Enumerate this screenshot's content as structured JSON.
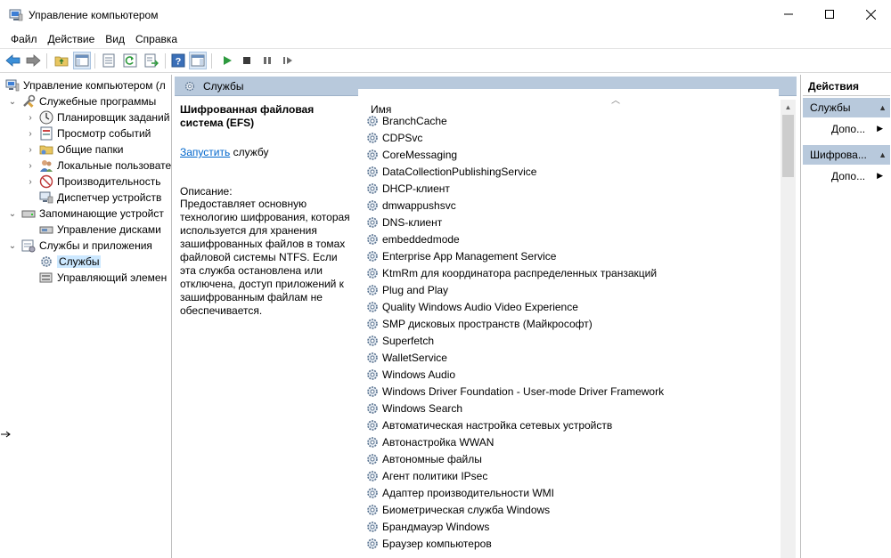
{
  "window": {
    "title": "Управление компьютером",
    "icon": "computer-management-icon"
  },
  "menu": [
    "Файл",
    "Действие",
    "Вид",
    "Справка"
  ],
  "toolbar": {
    "icons": [
      "back-arrow-icon",
      "forward-arrow-icon",
      "up-folder-icon",
      "show-hide-tree-icon",
      "properties-icon",
      "refresh-icon",
      "export-list-icon",
      "help-icon",
      "show-hide-action-pane-icon",
      "start-service-icon",
      "stop-service-icon",
      "pause-service-icon",
      "resume-service-icon"
    ]
  },
  "tree": {
    "items": [
      {
        "label": "Управление компьютером (л",
        "level": 0,
        "expander": "",
        "icon": "computer-management-icon"
      },
      {
        "label": "Служебные программы",
        "level": 1,
        "expander": "expanded",
        "icon": "tools-icon"
      },
      {
        "label": "Планировщик заданий",
        "level": 2,
        "expander": "collapsed",
        "icon": "clock-icon"
      },
      {
        "label": "Просмотр событий",
        "level": 2,
        "expander": "collapsed",
        "icon": "event-viewer-icon"
      },
      {
        "label": "Общие папки",
        "level": 2,
        "expander": "collapsed",
        "icon": "shared-folder-icon"
      },
      {
        "label": "Локальные пользовате",
        "level": 2,
        "expander": "collapsed",
        "icon": "users-icon"
      },
      {
        "label": "Производительность",
        "level": 2,
        "expander": "collapsed",
        "icon": "performance-icon"
      },
      {
        "label": "Диспетчер устройств",
        "level": 2,
        "expander": "",
        "icon": "device-manager-icon"
      },
      {
        "label": "Запоминающие устройст",
        "level": 1,
        "expander": "expanded",
        "icon": "storage-icon"
      },
      {
        "label": "Управление дисками",
        "level": 2,
        "expander": "",
        "icon": "disk-management-icon"
      },
      {
        "label": "Службы и приложения",
        "level": 1,
        "expander": "expanded",
        "icon": "services-apps-icon"
      },
      {
        "label": "Службы",
        "level": 2,
        "expander": "",
        "icon": "services-gear-icon",
        "selected": true
      },
      {
        "label": "Управляющий элемен",
        "level": 2,
        "expander": "",
        "icon": "wmi-control-icon"
      }
    ]
  },
  "center": {
    "header": "Службы",
    "detail": {
      "service_name": "Шифрованная файловая система (EFS)",
      "start_link": "Запустить",
      "start_suffix": " службу",
      "description_label": "Описание:",
      "description": "Предоставляет основную технологию шифрования, которая используется для хранения зашифрованных файлов в томах файловой системы NTFS. Если эта служба остановлена или отключена, доступ приложений к зашифрованным файлам не обеспечивается."
    },
    "list": {
      "column_name": "Имя",
      "services": [
        "BranchCache",
        "CDPSvc",
        "CoreMessaging",
        "DataCollectionPublishingService",
        "DHCP-клиент",
        "dmwappushsvc",
        "DNS-клиент",
        "embeddedmode",
        "Enterprise App Management Service",
        "KtmRm для координатора распределенных транзакций",
        "Plug and Play",
        "Quality Windows Audio Video Experience",
        "SMP дисковых пространств (Майкрософт)",
        "Superfetch",
        "WalletService",
        "Windows Audio",
        "Windows Driver Foundation - User-mode Driver Framework",
        "Windows Search",
        "Автоматическая настройка сетевых устройств",
        "Автонастройка WWAN",
        "Автономные файлы",
        "Агент политики IPsec",
        "Адаптер производительности WMI",
        "Биометрическая служба Windows",
        "Брандмауэр Windows",
        "Браузер компьютеров"
      ]
    }
  },
  "actions": {
    "title": "Действия",
    "groups": [
      {
        "label": "Службы",
        "item": "Допо..."
      },
      {
        "label": "Шифрова...",
        "item": "Допо..."
      }
    ]
  },
  "colors": {
    "header_band": "#b8c9dc",
    "selected": "#cce8ff",
    "link": "#0066cc"
  }
}
